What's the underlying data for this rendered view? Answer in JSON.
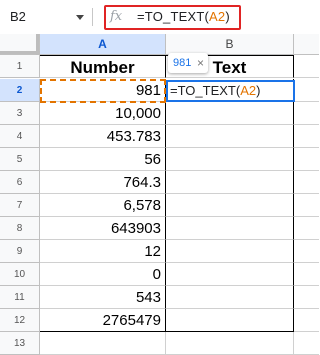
{
  "formula_bar": {
    "name_box": "B2",
    "fx_label": "fx",
    "formula_prefix": "=TO_TEXT(",
    "formula_ref": "A2",
    "formula_suffix": ")"
  },
  "columns": [
    "A",
    "B",
    ""
  ],
  "header_row": {
    "row_number": "1",
    "col_a": "Number",
    "col_b": "Text"
  },
  "rows": [
    {
      "row_number": "2",
      "number": "981"
    },
    {
      "row_number": "3",
      "number": "10,000"
    },
    {
      "row_number": "4",
      "number": "453.783"
    },
    {
      "row_number": "5",
      "number": "56"
    },
    {
      "row_number": "6",
      "number": "764.3"
    },
    {
      "row_number": "7",
      "number": "6,578"
    },
    {
      "row_number": "8",
      "number": "643903"
    },
    {
      "row_number": "9",
      "number": "12"
    },
    {
      "row_number": "10",
      "number": "0"
    },
    {
      "row_number": "11",
      "number": "543"
    },
    {
      "row_number": "12",
      "number": "2765479"
    },
    {
      "row_number": "13",
      "number": ""
    }
  ],
  "editor": {
    "prefix": "=TO_TEXT(",
    "ref": "A2",
    "suffix": ")"
  },
  "preview": {
    "value": "981",
    "close": "×"
  },
  "colors": {
    "highlight_box": "#e02424",
    "reference": "#e37400",
    "active": "#1a73e8",
    "selected_header": "#d3e3fd"
  }
}
